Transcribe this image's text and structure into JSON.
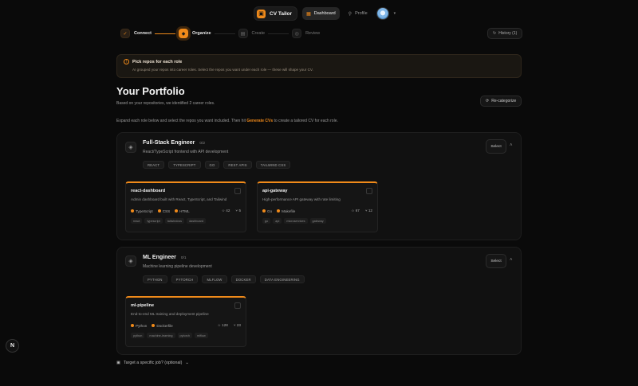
{
  "nav": {
    "brand_logo": "▣",
    "brand": "CV Tailor",
    "dashboard": "Dashboard",
    "profile": "Profile",
    "dashboard_icon": "▦",
    "profile_icon": "⚲",
    "avatar_caret": "▾"
  },
  "stepper": {
    "steps": [
      {
        "label": "Connect",
        "icon": "✓",
        "state": "done"
      },
      {
        "label": "Organize",
        "icon": "◆",
        "state": "current"
      },
      {
        "label": "Create",
        "icon": "▤",
        "state": "todo"
      },
      {
        "label": "Review",
        "icon": "◎",
        "state": "todo"
      }
    ]
  },
  "history": {
    "icon": "↻",
    "label": "History (1)"
  },
  "notice": {
    "icon": "!",
    "title": "Pick repos for each role",
    "body": "AI grouped your repos into career roles. Select the repos you want under each role — these will shape your CV."
  },
  "portfolio": {
    "title": "Your Portfolio",
    "subtitle": "Based on your repositories, we identified 2 career roles.",
    "recategorize_icon": "⟳",
    "recategorize": "Re-categorize",
    "instructions_pre": "Expand each role below and select the repos you want included. Then hit ",
    "instructions_hl": "Generate CVs",
    "instructions_post": " to create a tailored CV for each role."
  },
  "roles": [
    {
      "icon": "◈",
      "title": "Full-Stack Engineer",
      "count": "0/2",
      "desc": "React/TypeScript frontend with API development",
      "tags": [
        "REACT",
        "TYPESCRIPT",
        "GO",
        "REST APIS",
        "TAILWIND CSS"
      ],
      "select": "Select",
      "caret": "˄",
      "repos": [
        {
          "name": "react-dashboard",
          "desc": "Admin dashboard built with React, TypeScript, and Tailwind",
          "langs": [
            "TypeScript",
            "CSS",
            "HTML"
          ],
          "stars": "☆ 42",
          "forks": "⑂ 5",
          "topics": [
            "react",
            "typescript",
            "tailwindcss",
            "dashboard"
          ]
        },
        {
          "name": "api-gateway",
          "desc": "High-performance API gateway with rate limiting",
          "langs": [
            "Go",
            "Makefile"
          ],
          "stars": "☆ 67",
          "forks": "⑂ 12",
          "topics": [
            "go",
            "api",
            "microservices",
            "gateway"
          ]
        }
      ]
    },
    {
      "icon": "◈",
      "title": "ML Engineer",
      "count": "0/1",
      "desc": "Machine learning pipeline development",
      "tags": [
        "PYTHON",
        "PYTORCH",
        "MLFLOW",
        "DOCKER",
        "DATA ENGINEERING"
      ],
      "select": "Select",
      "caret": "˄",
      "repos": [
        {
          "name": "ml-pipeline",
          "desc": "End-to-end ML training and deployment pipeline",
          "langs": [
            "Python",
            "Dockerfile"
          ],
          "stars": "☆ 128",
          "forks": "⑂ 23",
          "topics": [
            "python",
            "machine-learning",
            "pytorch",
            "mlflow"
          ]
        }
      ]
    }
  ],
  "target_job": {
    "icon": "▣",
    "label": "Target a specific job? (optional)",
    "caret": "⌄"
  },
  "next_badge": "N",
  "colors": {
    "accent": "#f08a1a",
    "bg": "#0a0a0a",
    "card": "#111111"
  }
}
